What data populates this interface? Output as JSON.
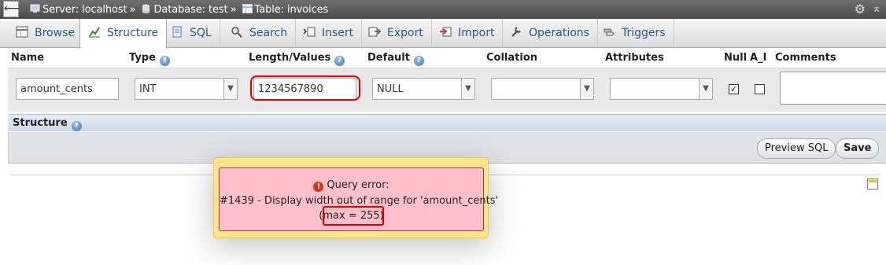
{
  "breadcrumb": {
    "back_glyph": "⟵",
    "server": "Server: localhost",
    "separator": "»",
    "database": "Database: test",
    "table": "Table: invoices"
  },
  "tabs": [
    {
      "label": "Browse",
      "icon": "browse-icon"
    },
    {
      "label": "Structure",
      "icon": "structure-icon"
    },
    {
      "label": "SQL",
      "icon": "sql-icon"
    },
    {
      "label": "Search",
      "icon": "search-icon"
    },
    {
      "label": "Insert",
      "icon": "insert-icon"
    },
    {
      "label": "Export",
      "icon": "export-icon"
    },
    {
      "label": "Import",
      "icon": "import-icon"
    },
    {
      "label": "Operations",
      "icon": "wrench-icon"
    },
    {
      "label": "Triggers",
      "icon": "triggers-icon"
    }
  ],
  "headers": {
    "name": "Name",
    "type": "Type",
    "length": "Length/Values",
    "default": "Default",
    "collation": "Collation",
    "attributes": "Attributes",
    "null": "Null",
    "ai": "A_I",
    "comments": "Comments"
  },
  "field": {
    "name": "amount_cents",
    "type": "INT",
    "length": "1234567890",
    "default": "NULL",
    "collation": "",
    "attributes": "",
    "null_checked": true,
    "ai_checked": false,
    "check_glyph": "✓"
  },
  "structure_label": "Structure",
  "buttons": {
    "preview_sql": "Preview SQL",
    "save": "Save"
  },
  "error": {
    "title": "Query error:",
    "message": "#1439 - Display width out of range for 'amount_cents'",
    "max": "(max = 255)",
    "icon_glyph": "!"
  },
  "help_glyph": "?",
  "colors": {
    "error_bg": "#ffc0cb",
    "popup_bg": "#ffe58a",
    "annotation_red": "#e00000",
    "tab_text": "#235a81"
  }
}
